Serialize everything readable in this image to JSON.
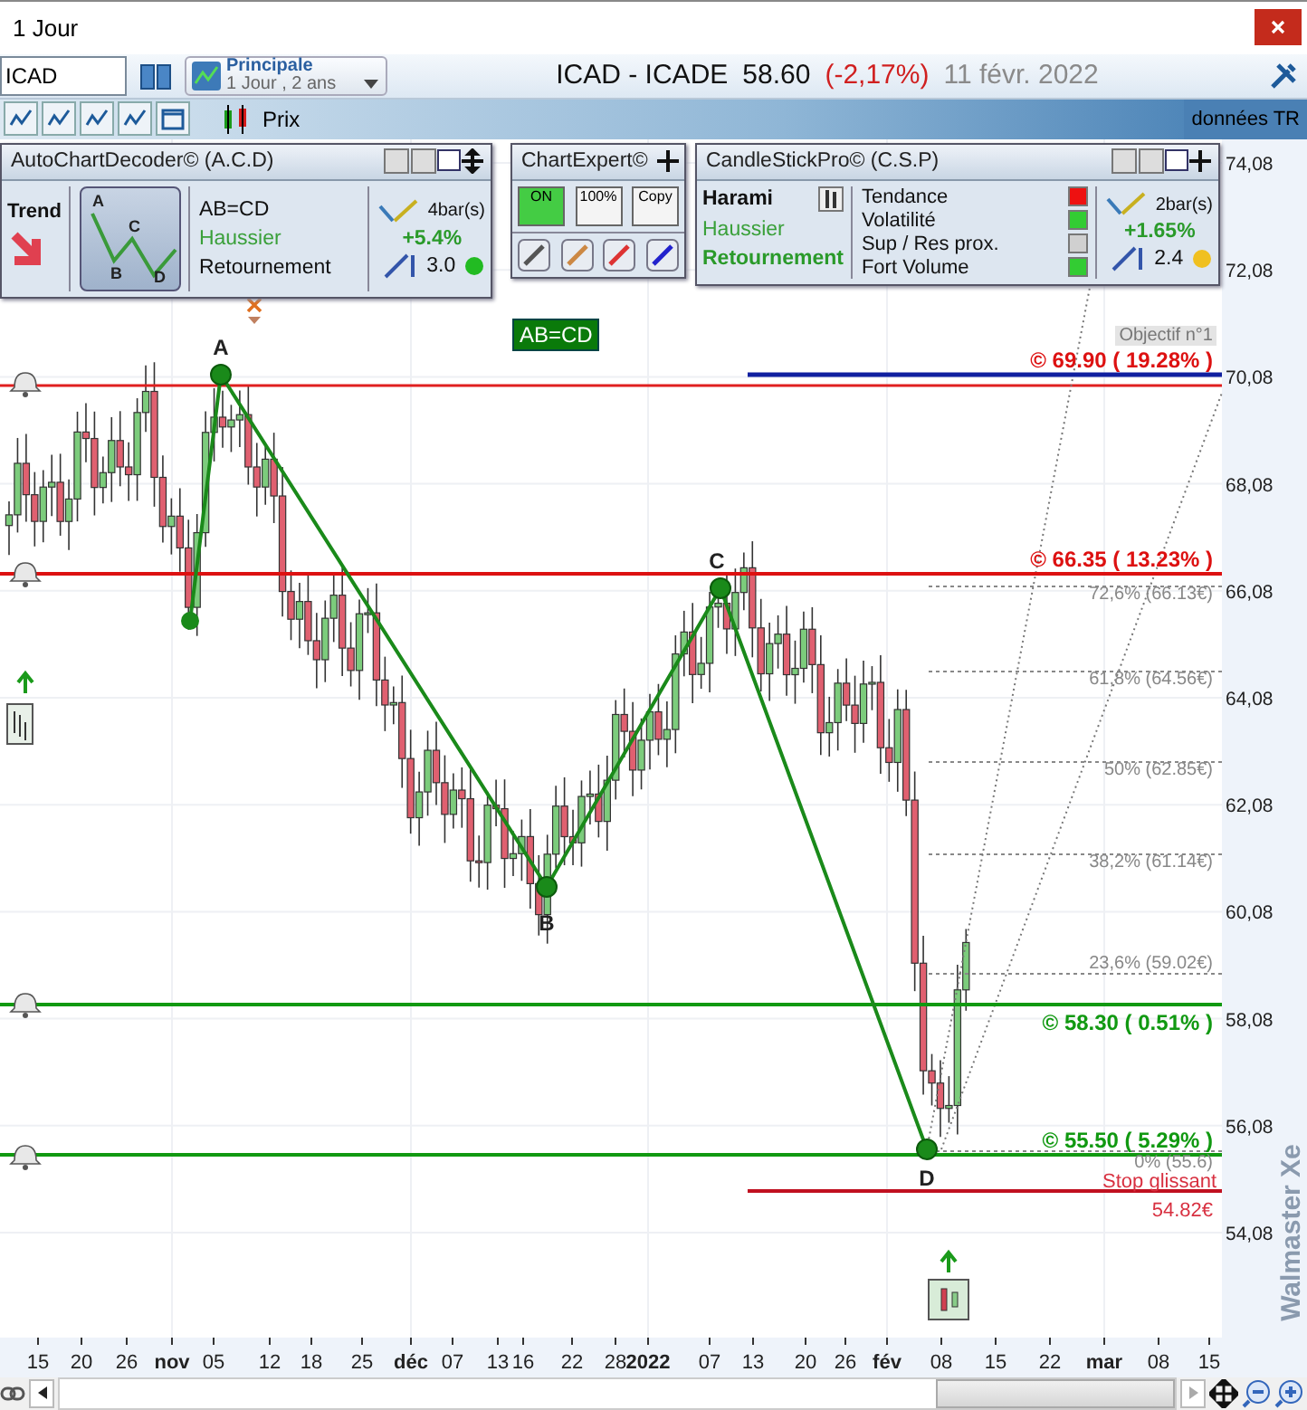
{
  "window": {
    "title": "1 Jour"
  },
  "toolbar": {
    "symbol": "ICAD",
    "layout": {
      "name": "Principale",
      "detail": "1 Jour , 2 ans"
    },
    "instrument": "ICAD - ICADE",
    "price": "58.60",
    "change": "(-2,17%)",
    "date": "11 févr. 2022"
  },
  "chart_toolbar": {
    "series_label": "Prix",
    "feed": "données TR"
  },
  "acd_panel": {
    "title": "AutoChartDecoder© (A.C.D)",
    "trend_label": "Trend",
    "thumb_points": [
      "A",
      "B",
      "C",
      "D"
    ],
    "pattern": "AB=CD",
    "direction": "Haussier",
    "type": "Retournement",
    "bars": "4bar(s)",
    "gain": "+5.4%",
    "ratio": "3.0",
    "confirmed": true
  },
  "chartexpert_panel": {
    "title": "ChartExpert©",
    "buttons": [
      "ON",
      "100%",
      "Copy"
    ]
  },
  "csp_panel": {
    "title": "CandleStickPro© (C.S.P)",
    "pattern": "Harami",
    "direction": "Haussier",
    "type": "Retournement",
    "criteria": [
      {
        "label": "Tendance",
        "color": "#ee1111"
      },
      {
        "label": "Volatilité",
        "color": "#33cc33"
      },
      {
        "label": "Sup / Res prox.",
        "color": "#d0d0d0"
      },
      {
        "label": "Fort Volume",
        "color": "#33cc33"
      }
    ],
    "bars": "2bar(s)",
    "gain": "+1.65%",
    "ratio": "2.4",
    "confirmed": false
  },
  "chart": {
    "pattern_tag": "AB=CD",
    "points": [
      "A",
      "B",
      "C",
      "D"
    ],
    "objective": "Objectif n°1",
    "levels": [
      {
        "label": "© 69.90 ( 19.28% )",
        "color": "#dd1111"
      },
      {
        "label": "© 66.35 ( 13.23% )",
        "color": "#dd1111"
      },
      {
        "label": "© 58.30 ( 0.51% )",
        "color": "#119911"
      },
      {
        "label": "© 55.50 ( 5.29% )",
        "color": "#119911"
      }
    ],
    "fib_labels": [
      "72,6% (66.13€)",
      "61,8% (64.56€)",
      "50% (62.85€)",
      "38,2% (61.14€)",
      "23,6% (59.02€)",
      "0% (55.6)"
    ],
    "stop": {
      "label": "Stop glissant",
      "value": "54.82€"
    },
    "price_axis": [
      "74,08",
      "72,08",
      "70,08",
      "68,08",
      "66,08",
      "64,08",
      "62,08",
      "60,08",
      "58,08",
      "56,08",
      "54,08"
    ],
    "date_axis": [
      {
        "label": "15",
        "bold": false
      },
      {
        "label": "20",
        "bold": false
      },
      {
        "label": "26",
        "bold": false
      },
      {
        "label": "nov",
        "bold": true
      },
      {
        "label": "05",
        "bold": false
      },
      {
        "label": "12",
        "bold": false
      },
      {
        "label": "18",
        "bold": false
      },
      {
        "label": "25",
        "bold": false
      },
      {
        "label": "déc",
        "bold": true
      },
      {
        "label": "07",
        "bold": false
      },
      {
        "label": "13",
        "bold": false
      },
      {
        "label": "16",
        "bold": false
      },
      {
        "label": "22",
        "bold": false
      },
      {
        "label": "28",
        "bold": false
      },
      {
        "label": "2022",
        "bold": true
      },
      {
        "label": "07",
        "bold": false
      },
      {
        "label": "13",
        "bold": false
      },
      {
        "label": "20",
        "bold": false
      },
      {
        "label": "26",
        "bold": false
      },
      {
        "label": "fév",
        "bold": true
      },
      {
        "label": "08",
        "bold": false
      },
      {
        "label": "15",
        "bold": false
      },
      {
        "label": "22",
        "bold": false
      },
      {
        "label": "mar",
        "bold": true
      },
      {
        "label": "08",
        "bold": false
      },
      {
        "label": "15",
        "bold": false
      }
    ],
    "brand": "Walmaster Xe"
  }
}
